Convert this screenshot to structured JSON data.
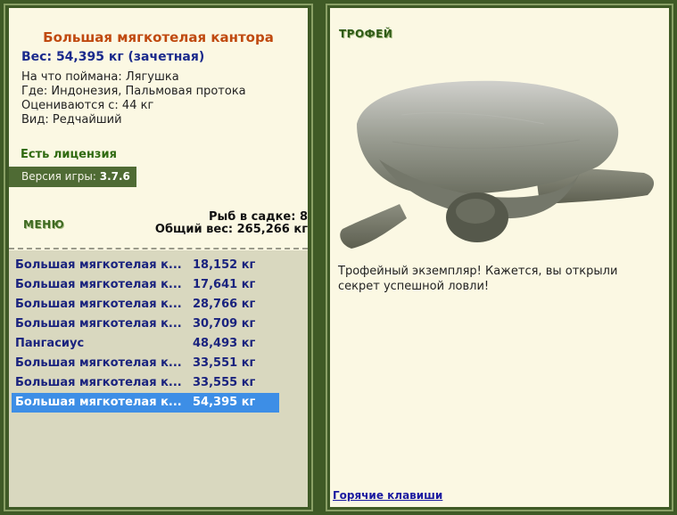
{
  "fish": {
    "title": "Большая мягкотелая кантора",
    "weight": "Вес: 54,395 кг (зачетная)",
    "caught_on": "На что поймана: Лягушка",
    "where": "Где: Индонезия, Пальмовая протока",
    "valued": "Оцениваются с: 44 кг",
    "kind": "Вид: Редчайший"
  },
  "license": "Есть лицензия",
  "version": {
    "label": "Версия игры:",
    "value": "3.7.6"
  },
  "menu_label": "МЕНЮ",
  "stats": {
    "in_cage": "Рыб в садке: 8",
    "total_weight": "Общий вес: 265,266 кг"
  },
  "catch_list": [
    {
      "name": "Большая мягкотелая к...",
      "weight": "18,152 кг"
    },
    {
      "name": "Большая мягкотелая к...",
      "weight": "17,641 кг"
    },
    {
      "name": "Большая мягкотелая к...",
      "weight": "28,766 кг"
    },
    {
      "name": "Большая мягкотелая к...",
      "weight": "30,709 кг"
    },
    {
      "name": "Пангасиус",
      "weight": "48,493 кг"
    },
    {
      "name": "Большая мягкотелая к...",
      "weight": "33,551 кг"
    },
    {
      "name": "Большая мягкотелая к...",
      "weight": "33,555 кг"
    },
    {
      "name": "Большая мягкотелая к...",
      "weight": "54,395 кг",
      "selected": true
    }
  ],
  "trophy": {
    "title": "ТРОФЕЙ",
    "description": "Трофейный экземпляр! Кажется, вы открыли секрет успешной ловли!"
  },
  "hotkeys_link": "Горячие клавиши",
  "colors": {
    "frame_bg": "#3f5a26",
    "panel_bg": "#fbf8e3",
    "list_bg": "#d9d8bf",
    "selected": "#3d8ee6",
    "title": "#c04a10"
  }
}
